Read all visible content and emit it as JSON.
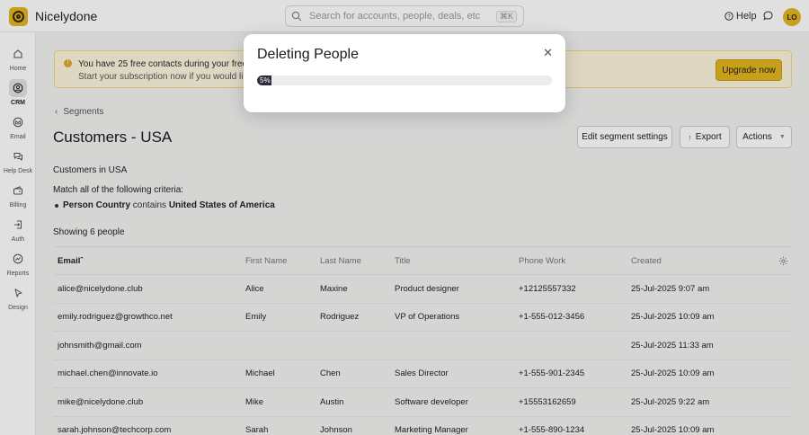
{
  "app": {
    "name": "Nicelydone"
  },
  "search": {
    "placeholder": "Search for accounts, people, deals, etc",
    "shortcut": "⌘K"
  },
  "header": {
    "help_label": "Help",
    "avatar_initials": "LO"
  },
  "sidebar": {
    "items": [
      {
        "label": "Home",
        "icon": "home-icon",
        "active": false
      },
      {
        "label": "CRM",
        "icon": "crm-icon",
        "active": true
      },
      {
        "label": "Email",
        "icon": "email-icon",
        "active": false
      },
      {
        "label": "Help Desk",
        "icon": "help-desk-icon",
        "active": false
      },
      {
        "label": "Billing",
        "icon": "billing-icon",
        "active": false
      },
      {
        "label": "Auth",
        "icon": "auth-icon",
        "active": false
      },
      {
        "label": "Reports",
        "icon": "reports-icon",
        "active": false
      },
      {
        "label": "Design",
        "icon": "design-icon",
        "active": false
      }
    ]
  },
  "banner": {
    "line1": "You have 25 free contacts during your free trial",
    "line2": "Start your subscription now if you would like to i",
    "upgrade_label": "Upgrade now"
  },
  "breadcrumb": {
    "label": "Segments"
  },
  "page": {
    "title": "Customers - USA",
    "edit_label": "Edit segment settings",
    "export_label": "Export",
    "actions_label": "Actions",
    "segment_name": "Customers in USA",
    "criteria_intro": "Match all of the following criteria:",
    "rule": {
      "field": "Person Country",
      "operator": "contains",
      "value": "United States of America"
    },
    "showing": "Showing 6 people"
  },
  "table": {
    "columns": [
      "Email",
      "First Name",
      "Last Name",
      "Title",
      "Phone Work",
      "Created"
    ],
    "sort_indicator": "ˆ",
    "rows": [
      [
        "alice@nicelydone.club",
        "Alice",
        "Maxine",
        "Product designer",
        "+12125557332",
        "25-Jul-2025 9:07 am"
      ],
      [
        "emily.rodriguez@growthco.net",
        "Emily",
        "Rodriguez",
        "VP of Operations",
        "+1-555-012-3456",
        "25-Jul-2025 10:09 am"
      ],
      [
        "johnsmith@gmail.com",
        "",
        "",
        "",
        "",
        "25-Jul-2025 11:33 am"
      ],
      [
        "michael.chen@innovate.io",
        "Michael",
        "Chen",
        "Sales Director",
        "+1-555-901-2345",
        "25-Jul-2025 10:09 am"
      ],
      [
        "mike@nicelydone.club",
        "Mike",
        "Austin",
        "Software developer",
        "+15553162659",
        "25-Jul-2025 9:22 am"
      ],
      [
        "sarah.johnson@techcorp.com",
        "Sarah",
        "Johnson",
        "Marketing Manager",
        "+1-555-890-1234",
        "25-Jul-2025 10:09 am"
      ]
    ]
  },
  "modal": {
    "title": "Deleting People",
    "progress": 0.05,
    "progress_label": "5%"
  },
  "colors": {
    "accent": "#e3b51f",
    "progress_fill": "#2f2a3b"
  }
}
